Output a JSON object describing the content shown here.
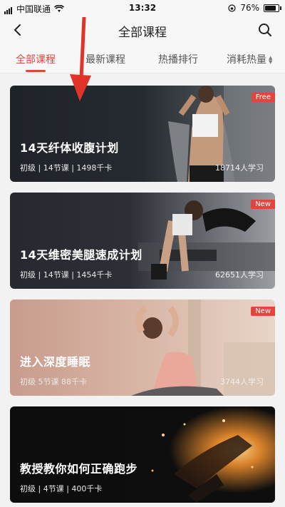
{
  "status_bar": {
    "carrier": "中国联通",
    "time": "13:32",
    "battery": "76%",
    "battery_level": 0.76
  },
  "nav": {
    "title": "全部课程",
    "back_icon": "chevron-left-icon",
    "search_icon": "search-icon"
  },
  "tabs": [
    {
      "label": "全部课程",
      "active": true
    },
    {
      "label": "最新课程",
      "active": false
    },
    {
      "label": "热播排行",
      "active": false
    },
    {
      "label": "消耗热量",
      "active": false
    }
  ],
  "accent": "#e2453c",
  "courses": [
    {
      "title": "14天纤体收腹计划",
      "meta": "初级 | 14节课 | 1498千卡",
      "learners": "18714人学习",
      "badge": "Free"
    },
    {
      "title": "14天维密美腿速成计划",
      "meta": "初级 | 14节课 | 1454千卡",
      "learners": "62651人学习",
      "badge": "New"
    },
    {
      "title": "进入深度睡眠",
      "meta": "初级  5节课  88千卡",
      "learners": "3744人学习",
      "badge": "New"
    },
    {
      "title": "教授教你如何正确跑步",
      "meta": "初级 | 4节课 | 400千卡",
      "learners": "",
      "badge": ""
    }
  ]
}
